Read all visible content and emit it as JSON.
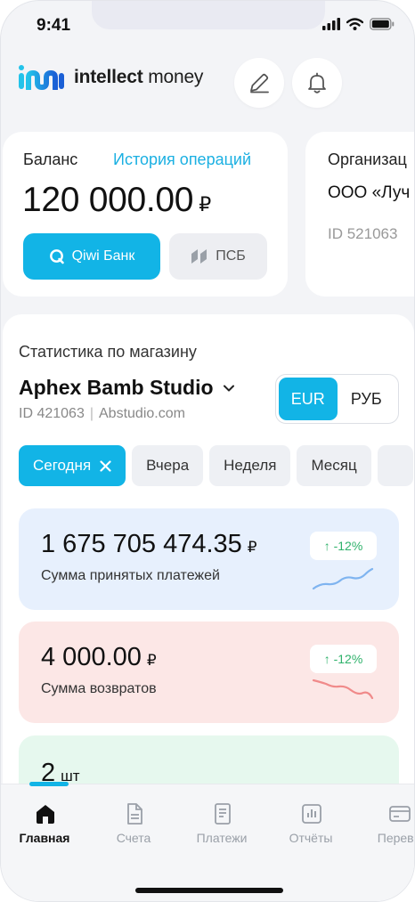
{
  "status_bar": {
    "time": "9:41"
  },
  "header": {
    "logo_brand": "intellect",
    "logo_suffix": " money",
    "edit_icon": "pencil-icon",
    "notifications_icon": "bell-icon"
  },
  "balance": {
    "label": "Баланс",
    "history_link": "История операций",
    "amount": "120 000.00",
    "currency": "₽",
    "qiwi_button": "Qiwi Банк",
    "psb_button": "ПСБ"
  },
  "organization": {
    "label": "Организац",
    "name": "ООО «Луч",
    "id": "ID 521063"
  },
  "stats": {
    "title": "Статистика по магазину",
    "shop_name": "Aphex Bamb Studio",
    "shop_id": "ID 421063",
    "shop_domain": "Abstudio.com",
    "currencies": [
      "EUR",
      "РУБ"
    ],
    "selected_currency": "EUR",
    "periods": [
      "Сегодня",
      "Вчера",
      "Неделя",
      "Месяц"
    ],
    "selected_period": "Сегодня",
    "metrics": [
      {
        "value": "1 675 705 474.35",
        "currency": "₽",
        "label": "Сумма принятых платежей",
        "badge": "↑ -12%"
      },
      {
        "value": "4 000.00",
        "currency": "₽",
        "label": "Сумма возвратов",
        "badge": "↑ -12%"
      },
      {
        "value": "2",
        "unit": "шт"
      }
    ]
  },
  "tabbar": {
    "items": [
      {
        "label": "Главная",
        "icon": "home-icon"
      },
      {
        "label": "Счета",
        "icon": "document-icon"
      },
      {
        "label": "Платежи",
        "icon": "receipt-icon"
      },
      {
        "label": "Отчёты",
        "icon": "chart-icon"
      },
      {
        "label": "Перево",
        "icon": "card-icon"
      }
    ],
    "active": "Главная"
  },
  "colors": {
    "accent": "#12b4e6",
    "link": "#1bb0e2",
    "positive": "#2fb26b",
    "payments_bg": "#e7f0fd",
    "refunds_bg": "#fce7e6",
    "count_bg": "#e6f8ee"
  }
}
